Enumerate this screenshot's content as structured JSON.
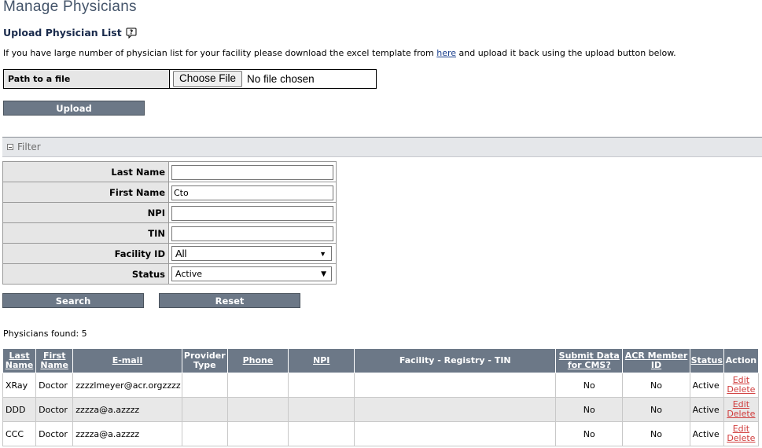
{
  "page": {
    "title": "Manage Physicians"
  },
  "upload": {
    "heading": "Upload Physician List",
    "intro_before": "If you have large number of physician list for your facility please download the excel template from ",
    "intro_link": "here",
    "intro_after": " and upload it back using the upload button below.",
    "path_label": "Path to a file",
    "choose_file_label": "Choose File",
    "no_file_text": "No file chosen",
    "upload_button": "Upload"
  },
  "filter": {
    "header": "Filter",
    "fields": {
      "last_name": {
        "label": "Last Name",
        "value": ""
      },
      "first_name": {
        "label": "First Name",
        "value": "Cto"
      },
      "npi": {
        "label": "NPI",
        "value": ""
      },
      "tin": {
        "label": "TIN",
        "value": ""
      },
      "facility_id": {
        "label": "Facility ID",
        "value": "All"
      },
      "status": {
        "label": "Status",
        "value": "Active"
      }
    },
    "search_button": "Search",
    "reset_button": "Reset"
  },
  "results": {
    "found_text": "Physicians found: 5",
    "columns": [
      {
        "label": "Last Name",
        "sortable": true
      },
      {
        "label": "First Name",
        "sortable": true
      },
      {
        "label": "E-mail",
        "sortable": true
      },
      {
        "label": "Provider Type",
        "sortable": false
      },
      {
        "label": "Phone",
        "sortable": true
      },
      {
        "label": "NPI",
        "sortable": true
      },
      {
        "label": "Facility - Registry - TIN",
        "sortable": false
      },
      {
        "label": "Submit Data for CMS?",
        "sortable": true
      },
      {
        "label": "ACR Member ID",
        "sortable": true
      },
      {
        "label": "Status",
        "sortable": true
      },
      {
        "label": "Action",
        "sortable": false
      }
    ],
    "rows": [
      {
        "last": "XRay",
        "first": "Doctor",
        "email": "zzzzlmeyer@acr.orgzzzz",
        "provider_type": "",
        "phone": "",
        "npi": "",
        "facility": "",
        "submit_cms": "No",
        "acr_id": "No",
        "status": "Active",
        "edit": "Edit",
        "delete": "Delete"
      },
      {
        "last": "DDD",
        "first": "Doctor",
        "email": "zzzza@a.azzzz",
        "provider_type": "",
        "phone": "",
        "npi": "",
        "facility": "",
        "submit_cms": "No",
        "acr_id": "No",
        "status": "Active",
        "edit": "Edit",
        "delete": "Delete"
      },
      {
        "last": "CCC",
        "first": "Doctor",
        "email": "zzzza@a.azzzz",
        "provider_type": "",
        "phone": "",
        "npi": "",
        "facility": "",
        "submit_cms": "No",
        "acr_id": "No",
        "status": "Active",
        "edit": "Edit",
        "delete": "Delete"
      }
    ]
  }
}
